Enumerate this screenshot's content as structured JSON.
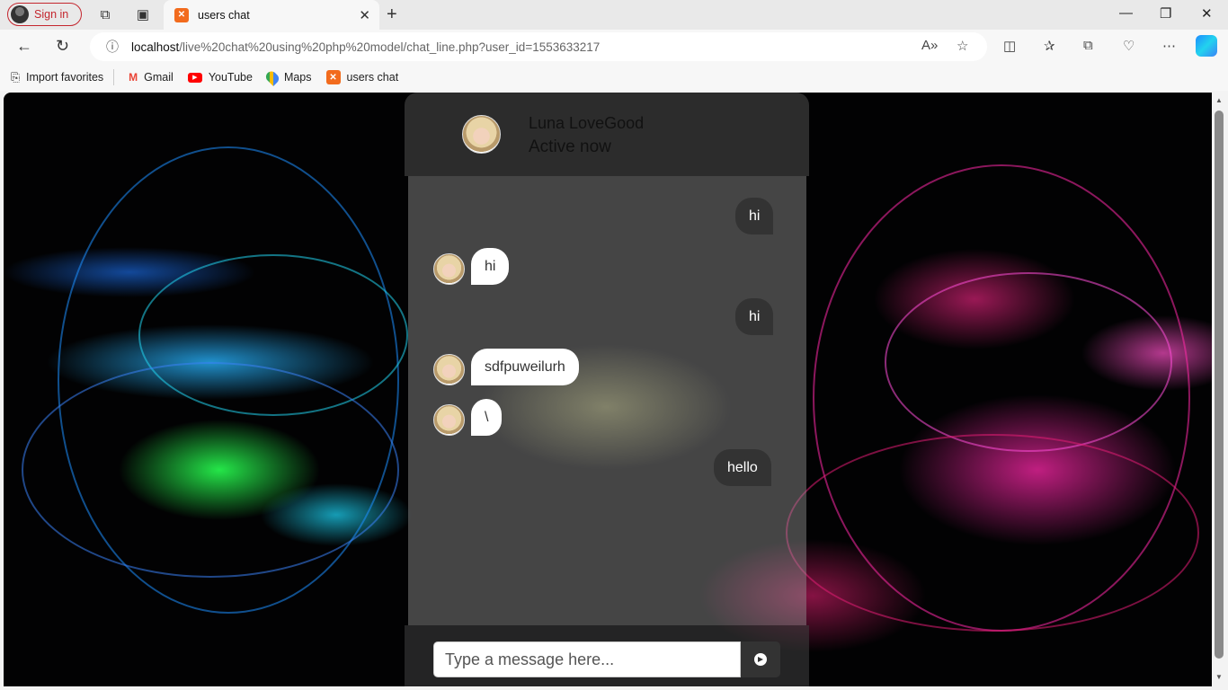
{
  "browser": {
    "sign_in": "Sign in",
    "tab_title": "users chat",
    "url_host": "localhost",
    "url_path": "/live%20chat%20using%20php%20model/chat_line.php?user_id=1553633217"
  },
  "bookmarks": [
    {
      "label": "Import favorites",
      "icon": "import-icon"
    },
    {
      "label": "Gmail",
      "icon": "gmail-icon"
    },
    {
      "label": "YouTube",
      "icon": "youtube-icon"
    },
    {
      "label": "Maps",
      "icon": "maps-icon"
    },
    {
      "label": "users chat",
      "icon": "xampp-icon"
    }
  ],
  "chat": {
    "name": "Luna LoveGood",
    "status": "Active now",
    "messages": [
      {
        "dir": "outgoing",
        "text": "hi"
      },
      {
        "dir": "incoming",
        "text": "hi"
      },
      {
        "dir": "outgoing",
        "text": "hi"
      },
      {
        "dir": "incoming",
        "text": "sdfpuweilurh"
      },
      {
        "dir": "incoming",
        "text": "\\"
      },
      {
        "dir": "outgoing",
        "text": "hello"
      }
    ],
    "input_placeholder": "Type a message here..."
  }
}
